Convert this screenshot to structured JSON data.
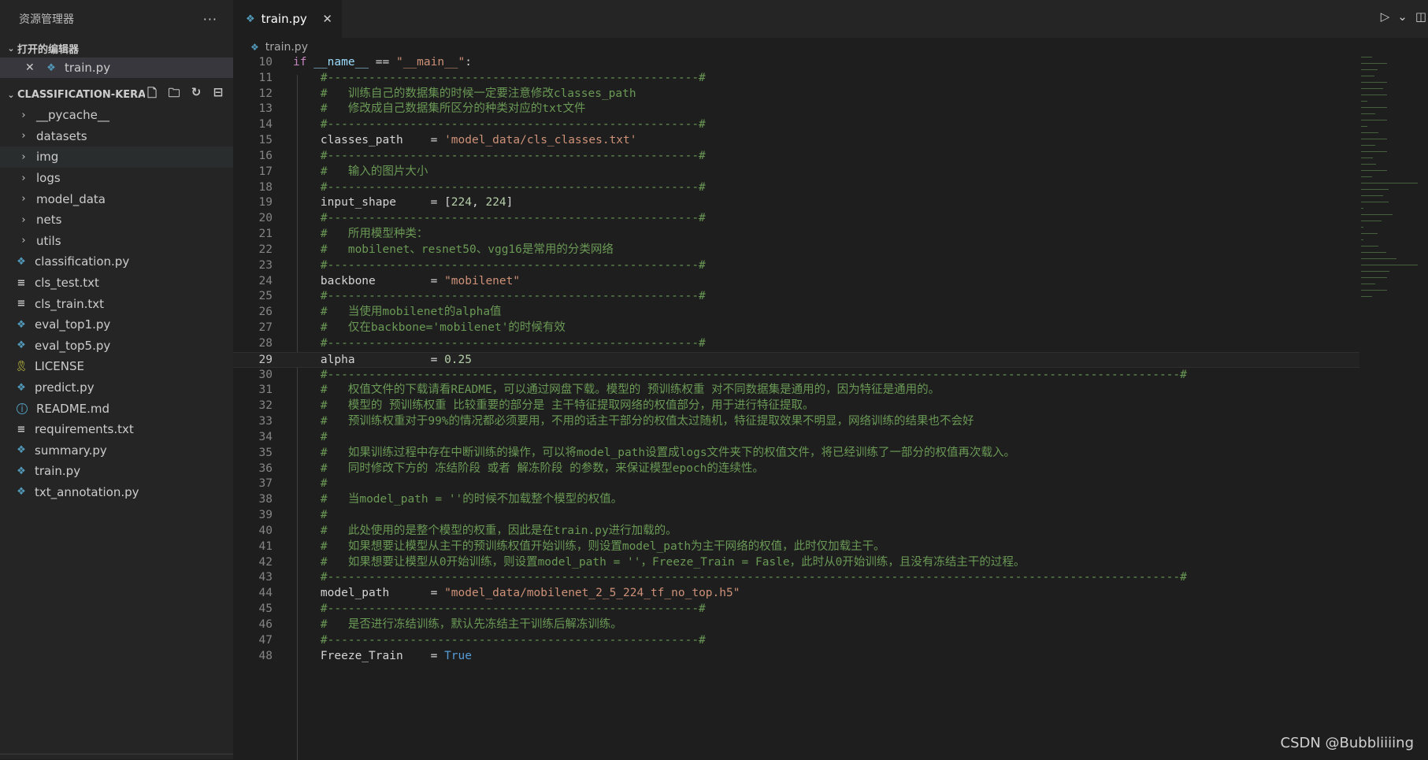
{
  "sidebar": {
    "title": "资源管理器",
    "more": "···",
    "open_editors": {
      "label": "打开的编辑器",
      "items": [
        {
          "close": "✕",
          "name": "train.py"
        }
      ]
    },
    "project": {
      "label": "CLASSIFICATION-KERA...",
      "actions": [
        "new-file",
        "new-folder",
        "refresh",
        "collapse-all"
      ],
      "tree": [
        {
          "name": "__pycache__",
          "type": "folder"
        },
        {
          "name": "datasets",
          "type": "folder"
        },
        {
          "name": "img",
          "type": "folder",
          "selected": true
        },
        {
          "name": "logs",
          "type": "folder"
        },
        {
          "name": "model_data",
          "type": "folder"
        },
        {
          "name": "nets",
          "type": "folder"
        },
        {
          "name": "utils",
          "type": "folder"
        },
        {
          "name": "classification.py",
          "type": "py"
        },
        {
          "name": "cls_test.txt",
          "type": "txt"
        },
        {
          "name": "cls_train.txt",
          "type": "txt"
        },
        {
          "name": "eval_top1.py",
          "type": "py"
        },
        {
          "name": "eval_top5.py",
          "type": "py"
        },
        {
          "name": "LICENSE",
          "type": "license"
        },
        {
          "name": "predict.py",
          "type": "py"
        },
        {
          "name": "README.md",
          "type": "info"
        },
        {
          "name": "requirements.txt",
          "type": "txt"
        },
        {
          "name": "summary.py",
          "type": "py"
        },
        {
          "name": "train.py",
          "type": "py"
        },
        {
          "name": "txt_annotation.py",
          "type": "py"
        }
      ]
    }
  },
  "editor": {
    "tab": {
      "label": "train.py",
      "close": "✕"
    },
    "breadcrumb": "train.py",
    "current_line": 29,
    "lines": [
      {
        "n": "10",
        "tokens": [
          [
            "kw",
            "if "
          ],
          [
            "dunder",
            "__name__"
          ],
          [
            "txt",
            " == "
          ],
          [
            "str",
            "\"__main__\""
          ],
          [
            "txt",
            ":"
          ]
        ]
      },
      {
        "n": "11",
        "tokens": [
          [
            "txt",
            "    "
          ],
          [
            "com",
            "#------------------------------------------------------#"
          ]
        ]
      },
      {
        "n": "12",
        "tokens": [
          [
            "txt",
            "    "
          ],
          [
            "com",
            "#   训练自己的数据集的时候一定要注意修改classes_path"
          ]
        ]
      },
      {
        "n": "13",
        "tokens": [
          [
            "txt",
            "    "
          ],
          [
            "com",
            "#   修改成自己数据集所区分的种类对应的txt文件"
          ]
        ]
      },
      {
        "n": "14",
        "tokens": [
          [
            "txt",
            "    "
          ],
          [
            "com",
            "#------------------------------------------------------#"
          ]
        ]
      },
      {
        "n": "15",
        "tokens": [
          [
            "txt",
            "    classes_path    = "
          ],
          [
            "str",
            "'model_data/cls_classes.txt'"
          ]
        ]
      },
      {
        "n": "16",
        "tokens": [
          [
            "txt",
            "    "
          ],
          [
            "com",
            "#------------------------------------------------------#"
          ]
        ]
      },
      {
        "n": "17",
        "tokens": [
          [
            "txt",
            "    "
          ],
          [
            "com",
            "#   输入的图片大小"
          ]
        ]
      },
      {
        "n": "18",
        "tokens": [
          [
            "txt",
            "    "
          ],
          [
            "com",
            "#------------------------------------------------------#"
          ]
        ]
      },
      {
        "n": "19",
        "tokens": [
          [
            "txt",
            "    input_shape     = ["
          ],
          [
            "num",
            "224"
          ],
          [
            "txt",
            ", "
          ],
          [
            "num",
            "224"
          ],
          [
            "txt",
            "]"
          ]
        ]
      },
      {
        "n": "20",
        "tokens": [
          [
            "txt",
            "    "
          ],
          [
            "com",
            "#------------------------------------------------------#"
          ]
        ]
      },
      {
        "n": "21",
        "tokens": [
          [
            "txt",
            "    "
          ],
          [
            "com",
            "#   所用模型种类："
          ]
        ]
      },
      {
        "n": "22",
        "tokens": [
          [
            "txt",
            "    "
          ],
          [
            "com",
            "#   mobilenet、resnet50、vgg16是常用的分类网络"
          ]
        ]
      },
      {
        "n": "23",
        "tokens": [
          [
            "txt",
            "    "
          ],
          [
            "com",
            "#------------------------------------------------------#"
          ]
        ]
      },
      {
        "n": "24",
        "tokens": [
          [
            "txt",
            "    backbone        = "
          ],
          [
            "str",
            "\"mobilenet\""
          ]
        ]
      },
      {
        "n": "25",
        "tokens": [
          [
            "txt",
            "    "
          ],
          [
            "com",
            "#------------------------------------------------------#"
          ]
        ]
      },
      {
        "n": "26",
        "tokens": [
          [
            "txt",
            "    "
          ],
          [
            "com",
            "#   当使用mobilenet的alpha值"
          ]
        ]
      },
      {
        "n": "27",
        "tokens": [
          [
            "txt",
            "    "
          ],
          [
            "com",
            "#   仅在backbone='mobilenet'的时候有效"
          ]
        ]
      },
      {
        "n": "28",
        "tokens": [
          [
            "txt",
            "    "
          ],
          [
            "com",
            "#------------------------------------------------------#"
          ]
        ]
      },
      {
        "n": "29",
        "tokens": [
          [
            "txt",
            "    alpha           = "
          ],
          [
            "num",
            "0.25"
          ]
        ]
      },
      {
        "n": "30",
        "tokens": [
          [
            "txt",
            "    "
          ],
          [
            "com",
            "#----------------------------------------------------------------------------------------------------------------------------#"
          ]
        ]
      },
      {
        "n": "31",
        "tokens": [
          [
            "txt",
            "    "
          ],
          [
            "com",
            "#   权值文件的下载请看README，可以通过网盘下载。模型的 预训练权重 对不同数据集是通用的，因为特征是通用的。"
          ]
        ]
      },
      {
        "n": "32",
        "tokens": [
          [
            "txt",
            "    "
          ],
          [
            "com",
            "#   模型的 预训练权重 比较重要的部分是 主干特征提取网络的权值部分，用于进行特征提取。"
          ]
        ]
      },
      {
        "n": "33",
        "tokens": [
          [
            "txt",
            "    "
          ],
          [
            "com",
            "#   预训练权重对于99%的情况都必须要用，不用的话主干部分的权值太过随机，特征提取效果不明显，网络训练的结果也不会好"
          ]
        ]
      },
      {
        "n": "34",
        "tokens": [
          [
            "txt",
            "    "
          ],
          [
            "com",
            "#"
          ]
        ]
      },
      {
        "n": "35",
        "tokens": [
          [
            "txt",
            "    "
          ],
          [
            "com",
            "#   如果训练过程中存在中断训练的操作，可以将model_path设置成logs文件夹下的权值文件，将已经训练了一部分的权值再次载入。"
          ]
        ]
      },
      {
        "n": "36",
        "tokens": [
          [
            "txt",
            "    "
          ],
          [
            "com",
            "#   同时修改下方的 冻结阶段 或者 解冻阶段 的参数，来保证模型epoch的连续性。"
          ]
        ]
      },
      {
        "n": "37",
        "tokens": [
          [
            "txt",
            "    "
          ],
          [
            "com",
            "#"
          ]
        ]
      },
      {
        "n": "38",
        "tokens": [
          [
            "txt",
            "    "
          ],
          [
            "com",
            "#   当model_path = ''的时候不加载整个模型的权值。"
          ]
        ]
      },
      {
        "n": "39",
        "tokens": [
          [
            "txt",
            "    "
          ],
          [
            "com",
            "#"
          ]
        ]
      },
      {
        "n": "40",
        "tokens": [
          [
            "txt",
            "    "
          ],
          [
            "com",
            "#   此处使用的是整个模型的权重，因此是在train.py进行加载的。"
          ]
        ]
      },
      {
        "n": "41",
        "tokens": [
          [
            "txt",
            "    "
          ],
          [
            "com",
            "#   如果想要让模型从主干的预训练权值开始训练，则设置model_path为主干网络的权值，此时仅加载主干。"
          ]
        ]
      },
      {
        "n": "42",
        "tokens": [
          [
            "txt",
            "    "
          ],
          [
            "com",
            "#   如果想要让模型从0开始训练，则设置model_path = ''，Freeze_Train = Fasle，此时从0开始训练，且没有冻结主干的过程。"
          ]
        ]
      },
      {
        "n": "43",
        "tokens": [
          [
            "txt",
            "    "
          ],
          [
            "com",
            "#----------------------------------------------------------------------------------------------------------------------------#"
          ]
        ]
      },
      {
        "n": "44",
        "tokens": [
          [
            "txt",
            "    model_path      = "
          ],
          [
            "str",
            "\"model_data/mobilenet_2_5_224_tf_no_top.h5\""
          ]
        ]
      },
      {
        "n": "45",
        "tokens": [
          [
            "txt",
            "    "
          ],
          [
            "com",
            "#------------------------------------------------------#"
          ]
        ]
      },
      {
        "n": "46",
        "tokens": [
          [
            "txt",
            "    "
          ],
          [
            "com",
            "#   是否进行冻结训练，默认先冻结主干训练后解冻训练。"
          ]
        ]
      },
      {
        "n": "47",
        "tokens": [
          [
            "txt",
            "    "
          ],
          [
            "com",
            "#------------------------------------------------------#"
          ]
        ]
      },
      {
        "n": "48",
        "tokens": [
          [
            "txt",
            "    Freeze_Train    = "
          ],
          [
            "const",
            "True"
          ]
        ]
      }
    ]
  },
  "watermark": "CSDN @Bubbliiiing",
  "colors": {
    "comment": "#6a9955",
    "string": "#ce9178",
    "keyword": "#c586c0",
    "number": "#b5cea8",
    "constant": "#569cd6",
    "text": "#d4d4d4"
  }
}
